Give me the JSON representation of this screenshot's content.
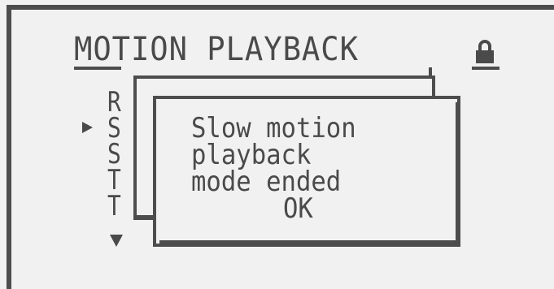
{
  "header": {
    "title": "MOTION PLAYBACK",
    "lock_icon": "lock-icon"
  },
  "menu": {
    "items": [
      {
        "label": "R",
        "selected": false
      },
      {
        "label": "S",
        "selected": true
      },
      {
        "label": "S",
        "selected": false
      },
      {
        "label": "T",
        "selected": false
      },
      {
        "label": "T",
        "selected": false
      }
    ],
    "cursor_icon": "triangle-right-icon",
    "scroll_icon": "triangle-down-icon"
  },
  "dialog": {
    "lines": [
      "Slow motion",
      "playback",
      "mode ended"
    ],
    "ok_label": "OK"
  },
  "colors": {
    "background": "#f1f1f1",
    "foreground": "#4a4a4a"
  }
}
